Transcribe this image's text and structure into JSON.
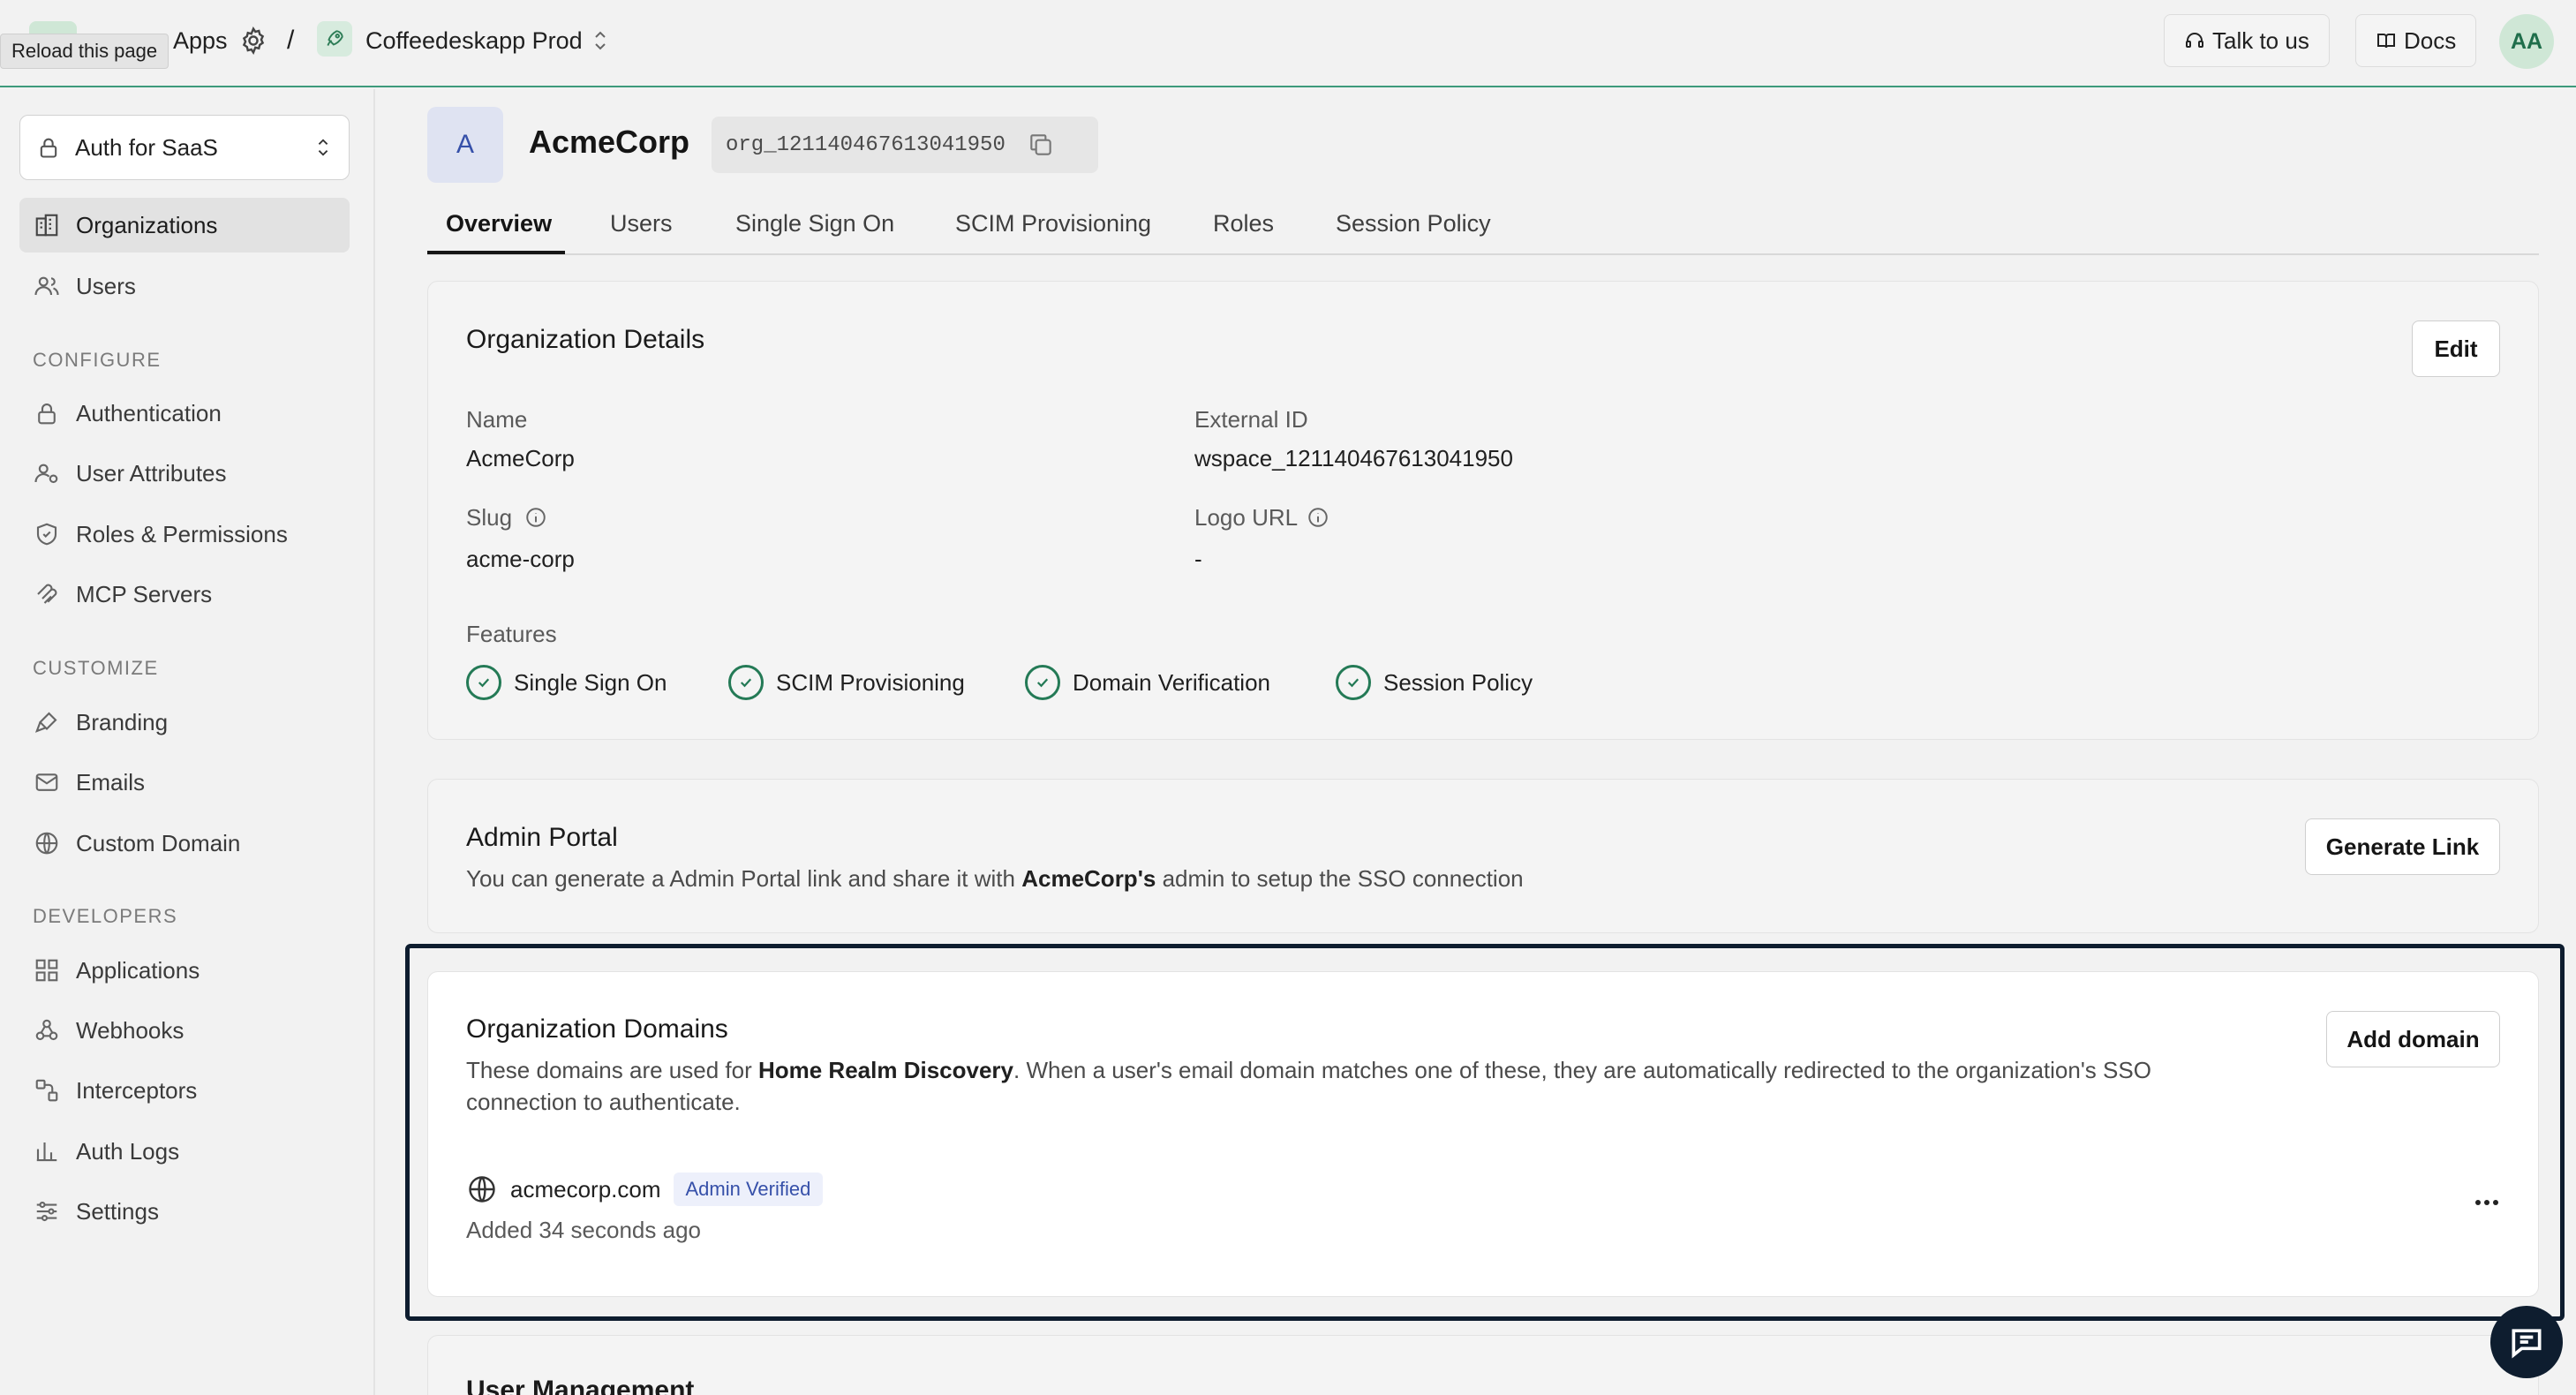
{
  "topbar": {
    "app_name_visible": "Apps",
    "separator": "/",
    "environment": "Coffeedeskapp Prod",
    "talk_label": "Talk to us",
    "docs_label": "Docs",
    "avatar_initials": "AA",
    "tooltip": "Reload this page"
  },
  "sidebar": {
    "product_select": "Auth for SaaS",
    "primary": [
      {
        "label": "Organizations",
        "icon": "building-icon"
      },
      {
        "label": "Users",
        "icon": "users-icon"
      }
    ],
    "sections": [
      {
        "title": "CONFIGURE",
        "items": [
          {
            "label": "Authentication",
            "icon": "lock-icon"
          },
          {
            "label": "User Attributes",
            "icon": "user-attributes-icon"
          },
          {
            "label": "Roles & Permissions",
            "icon": "shield-icon"
          },
          {
            "label": "MCP Servers",
            "icon": "mcp-icon"
          }
        ]
      },
      {
        "title": "CUSTOMIZE",
        "items": [
          {
            "label": "Branding",
            "icon": "brush-icon"
          },
          {
            "label": "Emails",
            "icon": "mail-icon"
          },
          {
            "label": "Custom Domain",
            "icon": "globe-icon"
          }
        ]
      },
      {
        "title": "DEVELOPERS",
        "items": [
          {
            "label": "Applications",
            "icon": "grid-icon"
          },
          {
            "label": "Webhooks",
            "icon": "webhook-icon"
          },
          {
            "label": "Interceptors",
            "icon": "interceptor-icon"
          },
          {
            "label": "Auth Logs",
            "icon": "chart-icon"
          },
          {
            "label": "Settings",
            "icon": "sliders-icon"
          }
        ]
      }
    ]
  },
  "org": {
    "avatar_letter": "A",
    "name": "AcmeCorp",
    "id": "org_121140467613041950"
  },
  "tabs": [
    "Overview",
    "Users",
    "Single Sign On",
    "SCIM Provisioning",
    "Roles",
    "Session Policy"
  ],
  "details": {
    "title": "Organization Details",
    "edit_label": "Edit",
    "name_label": "Name",
    "name_value": "AcmeCorp",
    "external_id_label": "External ID",
    "external_id_value": "wspace_121140467613041950",
    "slug_label": "Slug",
    "slug_value": "acme-corp",
    "logo_label": "Logo URL",
    "logo_value": "-",
    "features_label": "Features",
    "features": [
      "Single Sign On",
      "SCIM Provisioning",
      "Domain Verification",
      "Session Policy"
    ]
  },
  "admin_portal": {
    "title": "Admin Portal",
    "desc_prefix": "You can generate a Admin Portal link and share it with",
    "desc_bold": "AcmeCorp's",
    "desc_suffix": "admin to setup the SSO connection",
    "button": "Generate Link"
  },
  "domains": {
    "title": "Organization Domains",
    "desc_prefix": "These domains are used for",
    "desc_bold": "Home Realm Discovery",
    "desc_line1_suffix": ". When a user's email domain matches one of these, they are automatically redirected to the organization's SSO",
    "desc_line2": "connection to authenticate.",
    "button": "Add domain",
    "items": [
      {
        "domain": "acmecorp.com",
        "badge": "Admin Verified",
        "added": "Added 34 seconds ago"
      }
    ]
  },
  "next_section_title": "User Management",
  "colors": {
    "accent_green": "#247a56",
    "focus_outline": "#0e1d2f",
    "badge_blue": "#3650a9"
  }
}
